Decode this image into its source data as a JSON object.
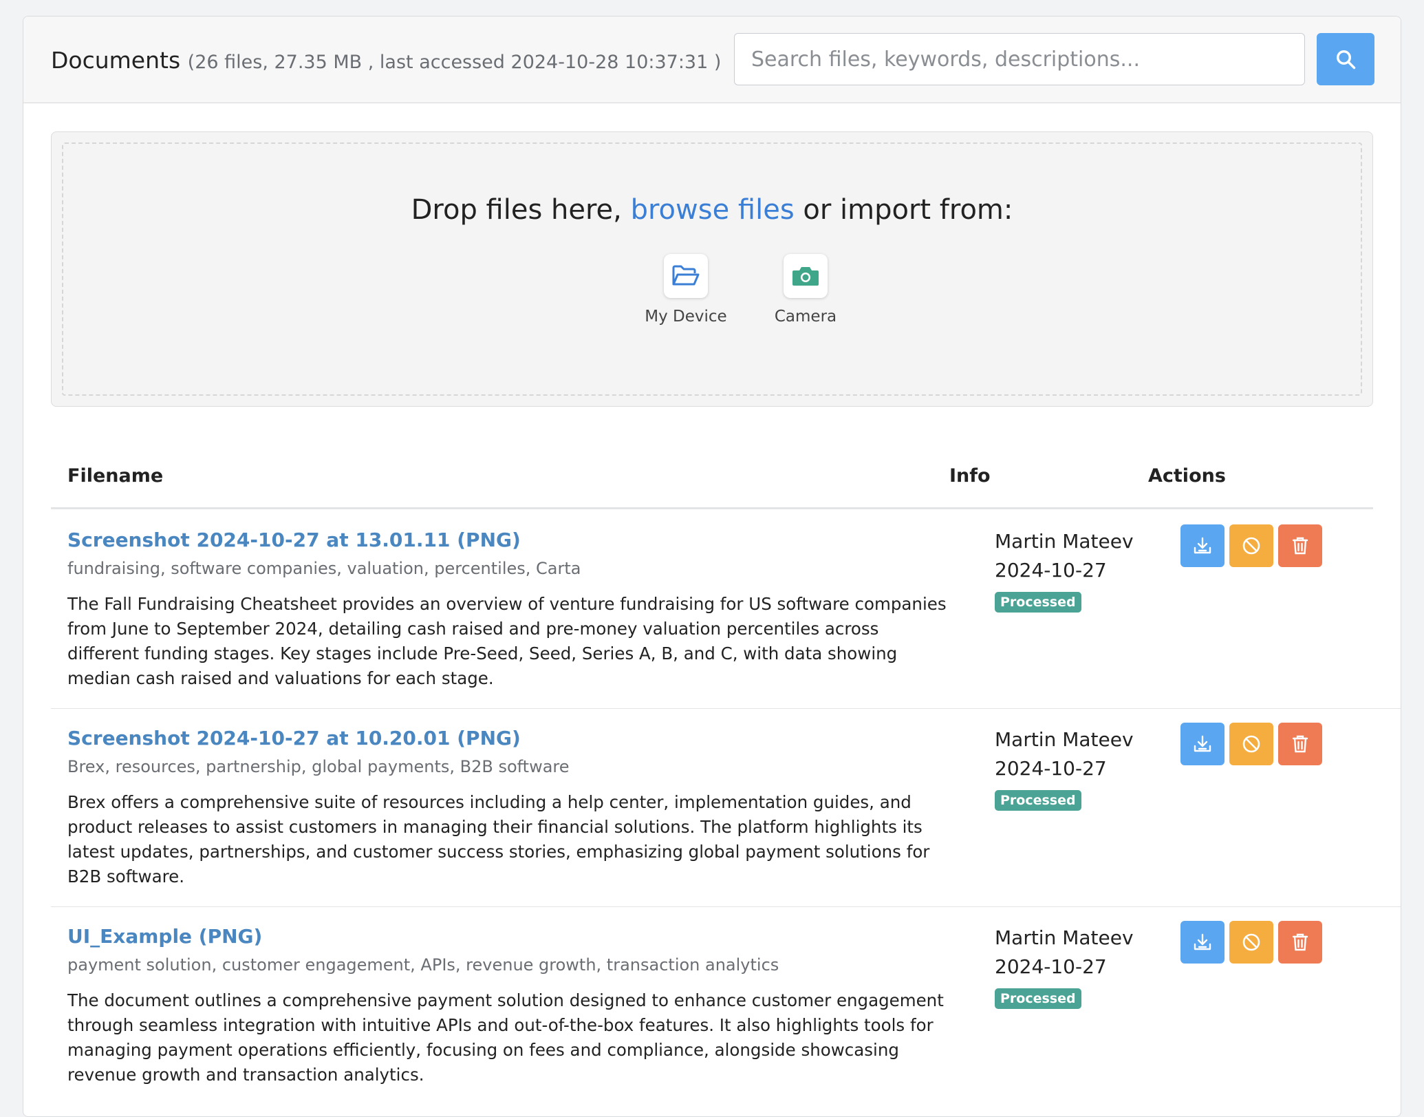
{
  "header": {
    "title": "Documents",
    "meta": "(26 files, 27.35 MB , last accessed 2024-10-28 10:37:31 )",
    "search_placeholder": "Search files, keywords, descriptions..."
  },
  "dropzone": {
    "text_before": "Drop files here, ",
    "browse_link": "browse files",
    "text_after": " or import from:",
    "sources": [
      {
        "label": "My Device",
        "icon": "folder-open-icon"
      },
      {
        "label": "Camera",
        "icon": "camera-icon"
      }
    ]
  },
  "table": {
    "headers": {
      "filename": "Filename",
      "info": "Info",
      "actions": "Actions"
    },
    "rows": [
      {
        "filename": "Screenshot 2024-10-27 at 13.01.11 (PNG)",
        "tags": "fundraising, software companies, valuation, percentiles, Carta",
        "description": "The Fall Fundraising Cheatsheet provides an overview of venture fundraising for US software companies from June to September 2024, detailing cash raised and pre-money valuation percentiles across different funding stages. Key stages include Pre-Seed, Seed, Series A, B, and C, with data showing median cash raised and valuations for each stage.",
        "owner": "Martin Mateev",
        "date": "2024-10-27",
        "status": "Processed"
      },
      {
        "filename": "Screenshot 2024-10-27 at 10.20.01 (PNG)",
        "tags": "Brex, resources, partnership, global payments, B2B software",
        "description": "Brex offers a comprehensive suite of resources including a help center, implementation guides, and product releases to assist customers in managing their financial solutions. The platform highlights its latest updates, partnerships, and customer success stories, emphasizing global payment solutions for B2B software.",
        "owner": "Martin Mateev",
        "date": "2024-10-27",
        "status": "Processed"
      },
      {
        "filename": "UI_Example (PNG)",
        "tags": "payment solution, customer engagement, APIs, revenue growth, transaction analytics",
        "description": "The document outlines a comprehensive payment solution designed to enhance customer engagement through seamless integration with intuitive APIs and out-of-the-box features. It also highlights tools for managing payment operations efficiently, focusing on fees and compliance, alongside showcasing revenue growth and transaction analytics.",
        "owner": "Martin Mateev",
        "date": "2024-10-27",
        "status": "Processed"
      }
    ]
  },
  "colors": {
    "accent": "#5aa6f0",
    "link": "#4a86bf",
    "status_processed": "#4aa394",
    "action_block": "#f5ad40",
    "action_delete": "#ef7b55"
  }
}
